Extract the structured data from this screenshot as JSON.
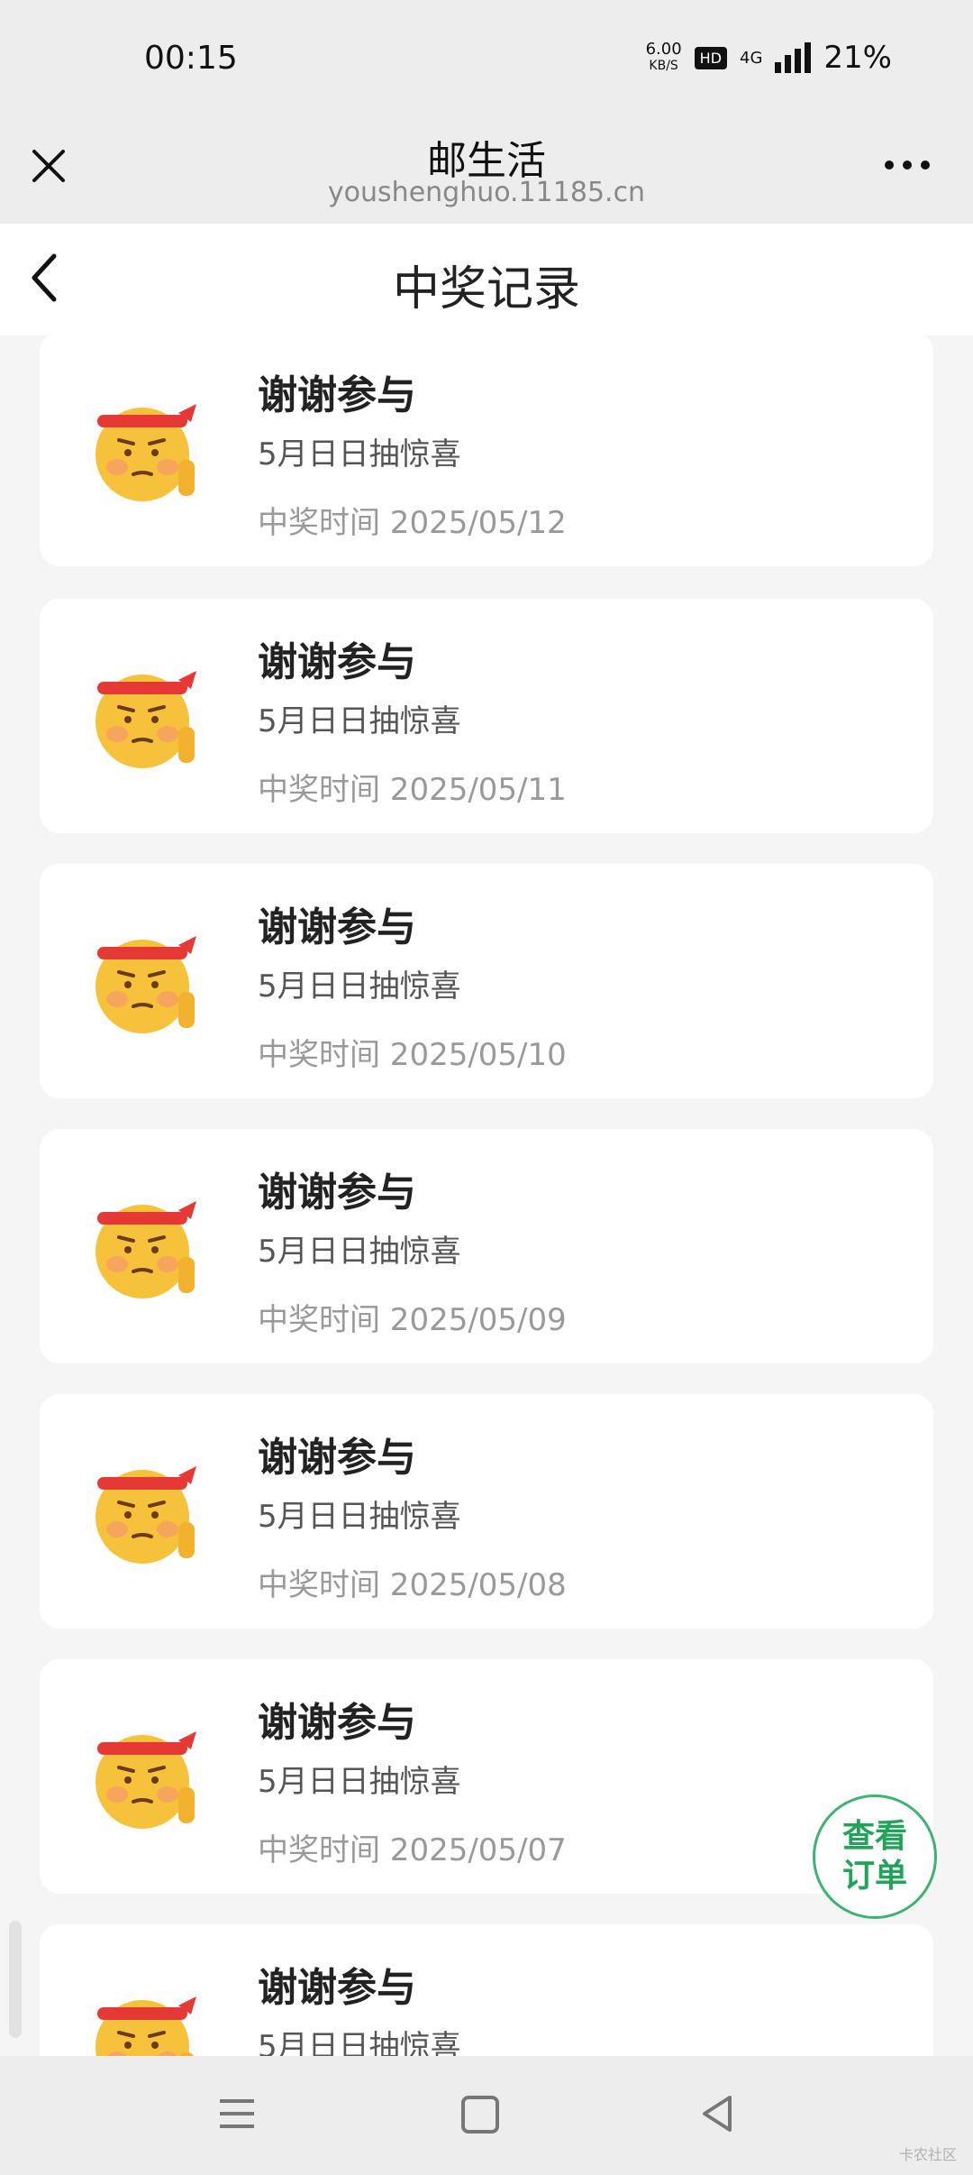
{
  "status_bar": {
    "time": "00:15",
    "net_speed_value": "6.00",
    "net_speed_unit": "KB/S",
    "hd_badge": "HD",
    "network": "4G",
    "battery": "21%"
  },
  "wx_header": {
    "title": "邮生活",
    "url": "youshenghuo.11185.cn"
  },
  "page": {
    "title": "中奖记录"
  },
  "records": [
    {
      "title": "谢谢参与",
      "subtitle": "5月日日抽惊喜",
      "time": "中奖时间 2025/05/12"
    },
    {
      "title": "谢谢参与",
      "subtitle": "5月日日抽惊喜",
      "time": "中奖时间 2025/05/11"
    },
    {
      "title": "谢谢参与",
      "subtitle": "5月日日抽惊喜",
      "time": "中奖时间 2025/05/10"
    },
    {
      "title": "谢谢参与",
      "subtitle": "5月日日抽惊喜",
      "time": "中奖时间 2025/05/09"
    },
    {
      "title": "谢谢参与",
      "subtitle": "5月日日抽惊喜",
      "time": "中奖时间 2025/05/08"
    },
    {
      "title": "谢谢参与",
      "subtitle": "5月日日抽惊喜",
      "time": "中奖时间 2025/05/07"
    },
    {
      "title": "谢谢参与",
      "subtitle": "5月日日抽惊喜",
      "time": ""
    }
  ],
  "fab": {
    "line1": "查看",
    "line2": "订单"
  },
  "icons": {
    "record": "cheer-emoji-icon",
    "close": "close-icon",
    "more": "more-icon",
    "back": "chevron-left-icon"
  },
  "colors": {
    "accent_green": "#22a35a",
    "emoji_face": "#f7c23b",
    "emoji_headband": "#e53935"
  },
  "watermark": "卡农社区"
}
